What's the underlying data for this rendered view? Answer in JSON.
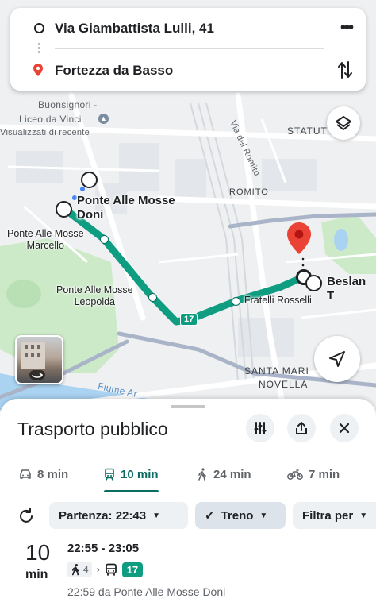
{
  "search": {
    "origin": "Via Giambattista Lulli, 41",
    "destination": "Fortezza da Basso"
  },
  "map": {
    "labels": {
      "buonsignori_1": "Buonsignori -",
      "buonsignori_2": "Liceo da Vinci",
      "visualizzati": "Visualizzati di recente",
      "via_romito": "Via del Romito",
      "statuto": "STATUT",
      "romito": "ROMITO",
      "santa_maria": "SANTA MARI",
      "novella": "NOVELLA",
      "fiume": "Fiume Ar"
    },
    "stops": {
      "doni_1": "Ponte Alle Mosse",
      "doni_2": "Doni",
      "marcello_1": "Ponte Alle Mosse",
      "marcello_2": "Marcello",
      "leopolda_1": "Ponte Alle Mosse",
      "leopolda_2": "Leopolda",
      "fratelli": "Fratelli Rosselli",
      "beslan": "Beslan T"
    },
    "route_line": "17",
    "route_color": "#0f9d82",
    "pin_color": "#ea4335"
  },
  "sheet": {
    "title": "Trasporto pubblico",
    "tabs": [
      {
        "icon": "car-icon",
        "label": "8 min"
      },
      {
        "icon": "train-icon",
        "label": "10 min"
      },
      {
        "icon": "walk-icon",
        "label": "24 min"
      },
      {
        "icon": "bike-icon",
        "label": "7 min"
      }
    ],
    "chips": {
      "partenza": "Partenza: 22:43",
      "treno": "Treno",
      "filtra": "Filtra per"
    },
    "result": {
      "duration_num": "10",
      "duration_unit": "min",
      "times": "22:55 - 23:05",
      "walk_minutes": "4",
      "line": "17",
      "departure": "22:59 da Ponte Alle Mosse Doni"
    },
    "accent": "#0b6d61"
  }
}
